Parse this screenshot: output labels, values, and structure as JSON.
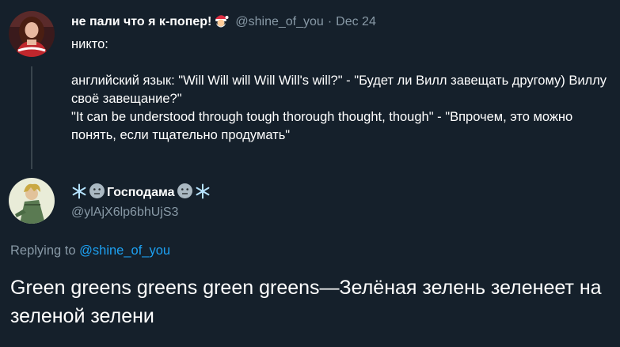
{
  "tweet1": {
    "display_name": "не пали что я к-попер!",
    "handle": "@shine_of_you",
    "separator": "·",
    "date": "Dec 24",
    "lines": [
      "никто:",
      "английский язык: \"Will Will will Will Will's will?\" - \"Будет ли Вилл завещать другому) Виллу своё завещание?\"",
      "\"It can be understood through tough thorough thought, though\" - \"Впрочем, это можно понять, если тщательно продумать\""
    ]
  },
  "tweet2": {
    "display_name": "Господама",
    "handle": "@ylAjX6lp6bhUjS3",
    "replying_prefix": "Replying to",
    "replying_handle": "@shine_of_you",
    "text": "Green greens greens green greens—Зелёная зелень зеленеет на зеленой зелени"
  },
  "colors": {
    "background": "#15202b",
    "text": "#ffffff",
    "muted": "#8899a6",
    "link": "#1da1f2",
    "thread_line": "#38444d"
  },
  "icons": [
    "santa-face-emoji",
    "snowflake-emoji",
    "neutral-face-emoji"
  ]
}
